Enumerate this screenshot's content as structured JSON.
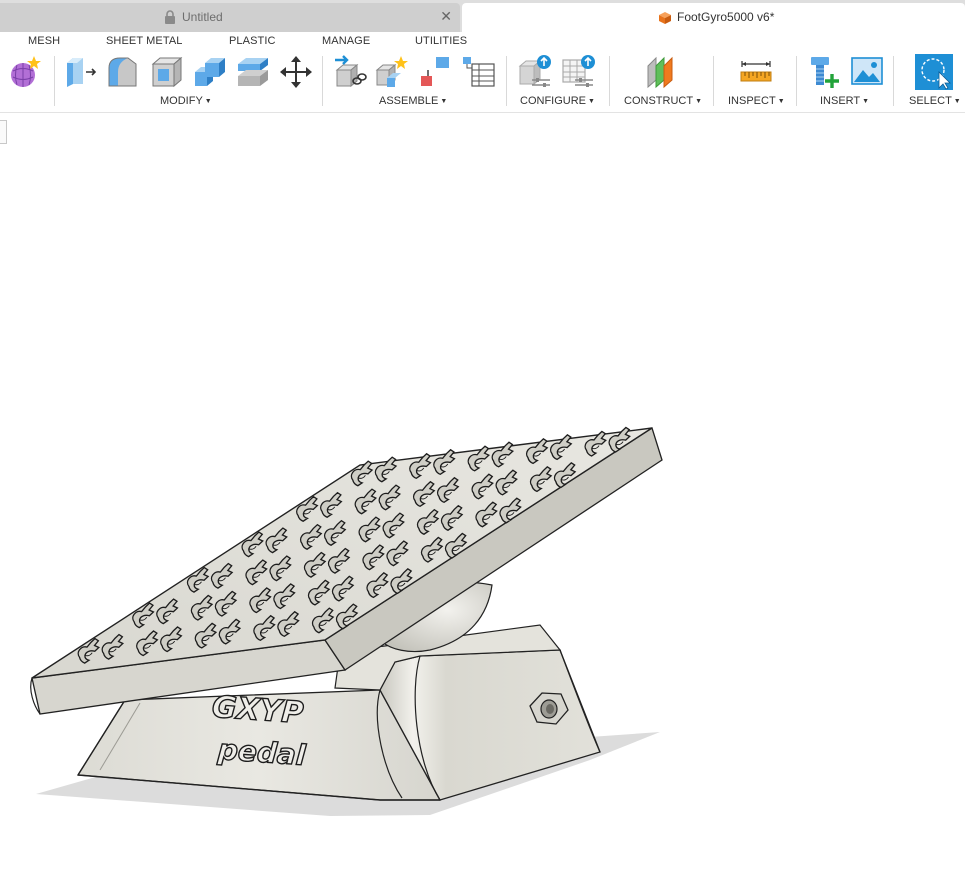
{
  "tabs": [
    {
      "label": "Untitled",
      "close": "✕"
    },
    {
      "label": "FootGyro5000 v6*"
    }
  ],
  "menu_tabs": [
    "MESH",
    "SHEET METAL",
    "PLASTIC",
    "MANAGE",
    "UTILITIES"
  ],
  "groups": {
    "modify": "MODIFY",
    "assemble": "ASSEMBLE",
    "configure": "CONFIGURE",
    "construct": "CONSTRUCT",
    "inspect": "INSPECT",
    "insert": "INSERT",
    "select": "SELECT"
  },
  "caret": "▼",
  "model_text": {
    "line1": "GXYP",
    "line2": "pedal"
  },
  "colors": {
    "accent_blue": "#1e8fd5",
    "orange": "#f07a1e",
    "part_face": "#e6e5df",
    "part_shade": "#cfcdc4"
  }
}
